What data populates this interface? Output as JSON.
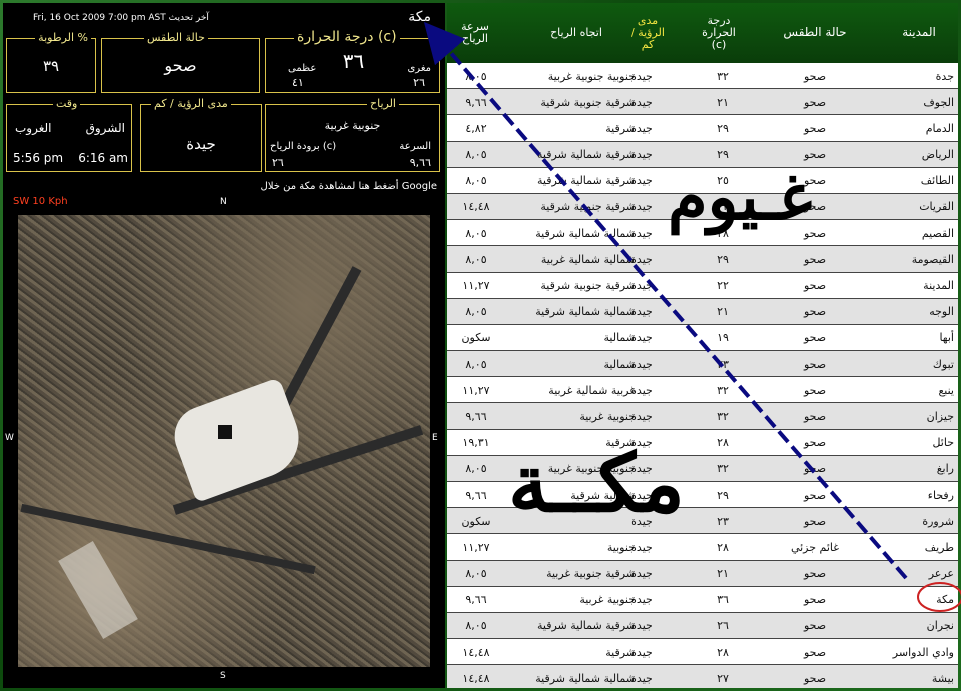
{
  "header": {
    "city": "مكة",
    "update_label": "آخر تحديث",
    "update_time": "Fri, 16 Oct 2009 7:00 pm AST"
  },
  "humidity": {
    "title": "الرطوبة %",
    "value": "٣٩"
  },
  "condition": {
    "title": "حالة الطقس",
    "value": "صحو"
  },
  "temperature": {
    "title": "درجة الحرارة (c)",
    "value": "٣٦",
    "max_label": "عظمى",
    "max_value": "٤١",
    "min_label": "مغرى",
    "min_value": "٢٦"
  },
  "time": {
    "title": "وقت",
    "sunset_label": "الغروب",
    "sunset_value": "5:56 pm",
    "sunrise_label": "الشروق",
    "sunrise_value": "6:16 am"
  },
  "visibility": {
    "title": "مدى الرؤية / كم",
    "value": "جيدة"
  },
  "wind": {
    "title": "الرياح",
    "direction": "جنوبية غربية",
    "speed_label": "السرعة",
    "speed_value": "٩,٦٦",
    "chill_label": "برودة الرياح (c)",
    "chill_value": "٢٦"
  },
  "map": {
    "link_text": "أضغط هنا لمشاهدة مكة من خلال Google",
    "wind_readout": "SW 10 Kph",
    "north": "N",
    "south": "S",
    "east": "E",
    "west": "W"
  },
  "table": {
    "headers": {
      "city": "المدينة",
      "condition": "حالة الطقس",
      "temp": "درجة الحرارة (c)",
      "visibility": "مدى الرؤية / كم",
      "wind_dir": "اتجاه الرياح",
      "wind_speed": "سرعة الرياح"
    },
    "rows": [
      {
        "city": "جدة",
        "cond": "صحو",
        "temp": "٣٢",
        "vis": "جيدة",
        "dir": "جنوبية جنوبية غربية",
        "speed": "٨,٠٥"
      },
      {
        "city": "الجوف",
        "cond": "صحو",
        "temp": "٢١",
        "vis": "جيدة",
        "dir": "شرقية جنوبية شرقية",
        "speed": "٩,٦٦"
      },
      {
        "city": "الدمام",
        "cond": "صحو",
        "temp": "٢٩",
        "vis": "جيدة",
        "dir": "شرقية",
        "speed": "٤,٨٢"
      },
      {
        "city": "الرياض",
        "cond": "صحو",
        "temp": "٢٩",
        "vis": "جيدة",
        "dir": "شرقية شمالية شرقية",
        "speed": "٨,٠٥"
      },
      {
        "city": "الطائف",
        "cond": "صحو",
        "temp": "٢٥",
        "vis": "جيدة",
        "dir": "شرقية شمالية شرقية",
        "speed": "٨,٠٥"
      },
      {
        "city": "القريات",
        "cond": "صحو",
        "temp": "٢٢",
        "vis": "جيدة",
        "dir": "شرقية جنوبية شرقية",
        "speed": "١٤,٤٨"
      },
      {
        "city": "القصيم",
        "cond": "صحو",
        "temp": "٢٨",
        "vis": "جيدة",
        "dir": "شمالية شمالية شرقية",
        "speed": "٨,٠٥"
      },
      {
        "city": "القيصومة",
        "cond": "صحو",
        "temp": "٢٩",
        "vis": "جيدة",
        "dir": "شمالية شمالية غربية",
        "speed": "٨,٠٥"
      },
      {
        "city": "المدينة",
        "cond": "صحو",
        "temp": "٢٢",
        "vis": "جيدة",
        "dir": "شرقية جنوبية شرقية",
        "speed": "١١,٢٧"
      },
      {
        "city": "الوجه",
        "cond": "صحو",
        "temp": "٢١",
        "vis": "جيدة",
        "dir": "شمالية شمالية شرقية",
        "speed": "٨,٠٥"
      },
      {
        "city": "أبها",
        "cond": "صحو",
        "temp": "١٩",
        "vis": "جيدة",
        "dir": "شمالية",
        "speed": "سكون"
      },
      {
        "city": "تبوك",
        "cond": "صحو",
        "temp": "٢٣",
        "vis": "جيدة",
        "dir": "شمالية",
        "speed": "٨,٠٥"
      },
      {
        "city": "ينبع",
        "cond": "صحو",
        "temp": "٣٢",
        "vis": "جيدة",
        "dir": "غربية شمالية غربية",
        "speed": "١١,٢٧"
      },
      {
        "city": "جيزان",
        "cond": "صحو",
        "temp": "٣٢",
        "vis": "جيدة",
        "dir": "جنوبية غربية",
        "speed": "٩,٦٦"
      },
      {
        "city": "حائل",
        "cond": "صحو",
        "temp": "٢٨",
        "vis": "جيدة",
        "dir": "شرقية",
        "speed": "١٩,٣١"
      },
      {
        "city": "رابغ",
        "cond": "صحو",
        "temp": "٣٢",
        "vis": "جيدة",
        "dir": "جنوبية جنوبية غربية",
        "speed": "٨,٠٥"
      },
      {
        "city": "رفحاء",
        "cond": "صحو",
        "temp": "٢٩",
        "vis": "جيدة",
        "dir": "شمالية شرقية",
        "speed": "٩,٦٦"
      },
      {
        "city": "شرورة",
        "cond": "صحو",
        "temp": "٢٣",
        "vis": "جيدة",
        "dir": "",
        "speed": "سكون"
      },
      {
        "city": "طريف",
        "cond": "غائم جزئي",
        "temp": "٢٨",
        "vis": "جيدة",
        "dir": "جنوبية",
        "speed": "١١,٢٧"
      },
      {
        "city": "عرعر",
        "cond": "صحو",
        "temp": "٢١",
        "vis": "جيدة",
        "dir": "شرقية جنوبية غربية",
        "speed": "٨,٠٥"
      },
      {
        "city": "مكة",
        "cond": "صحو",
        "temp": "٣٦",
        "vis": "جيدة",
        "dir": "جنوبية غربية",
        "speed": "٩,٦٦"
      },
      {
        "city": "نجران",
        "cond": "صحو",
        "temp": "٢٦",
        "vis": "جيدة",
        "dir": "شرقية شمالية شرقية",
        "speed": "٨,٠٥"
      },
      {
        "city": "وادي الدواسر",
        "cond": "صحو",
        "temp": "٢٨",
        "vis": "جيدة",
        "dir": "شرقية",
        "speed": "١٤,٤٨"
      },
      {
        "city": "بيشة",
        "cond": "صحو",
        "temp": "٢٧",
        "vis": "جيدة",
        "dir": "شمالية شمالية شرقية",
        "speed": "١٤,٤٨"
      }
    ]
  },
  "annotations": {
    "clouds_word": "غـيوم",
    "makkah_word": "مكــة"
  },
  "colors": {
    "frame_green": "#1e6b1e",
    "panel_gold": "#d9c24a",
    "header_green": "#0f5a0f",
    "arrow_blue": "#0a0a80",
    "circle_red": "#cc2222"
  }
}
